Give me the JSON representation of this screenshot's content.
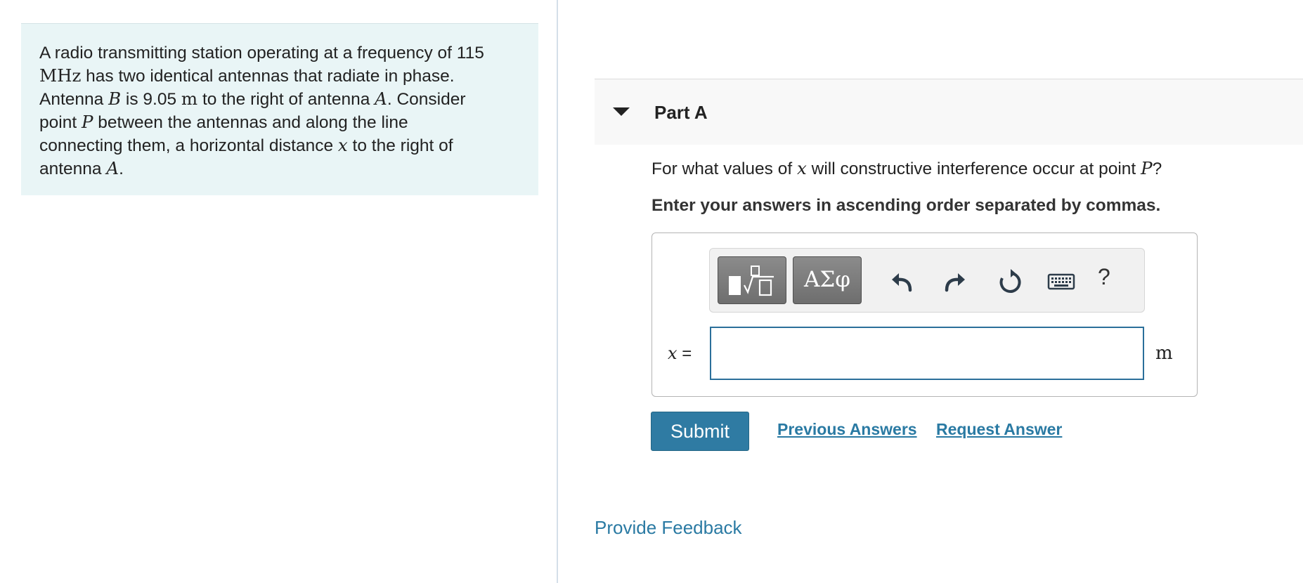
{
  "problem": {
    "l1_a": "A radio transmitting station operating at a frequency of 115",
    "l2_unit": "MHz",
    "l2_b": " has two identical antennas that radiate in phase.",
    "l3_a": "Antenna ",
    "l3_var_b": "B",
    "l3_b": " is 9.05 ",
    "l3_unit": "m",
    "l3_c": " to the right of antenna ",
    "l3_var_a": "A",
    "l3_d": ". Consider",
    "l4_a": "point ",
    "l4_var_p": "P",
    "l4_b": " between the antennas and along the line",
    "l5_a": "connecting them, a horizontal distance ",
    "l5_var_x": "x",
    "l5_b": " to the right of",
    "l6_a": "antenna ",
    "l6_var_a": "A",
    "l6_b": "."
  },
  "part": {
    "title": "Part A",
    "question_a": "For what values of ",
    "question_var_x": "x",
    "question_b": " will constructive interference occur at point ",
    "question_var_p": "P",
    "question_c": "?",
    "instruction": "Enter your answers in ascending order separated by commas."
  },
  "toolbar": {
    "symbols_label": "ΑΣφ",
    "help_label": "?"
  },
  "answer": {
    "variable": "x",
    "equals": " =",
    "value": "",
    "unit": "m"
  },
  "actions": {
    "submit_label": "Submit",
    "previous_answers_label": "Previous Answers",
    "request_answer_label": "Request Answer"
  },
  "footer": {
    "feedback_label": "Provide Feedback"
  }
}
